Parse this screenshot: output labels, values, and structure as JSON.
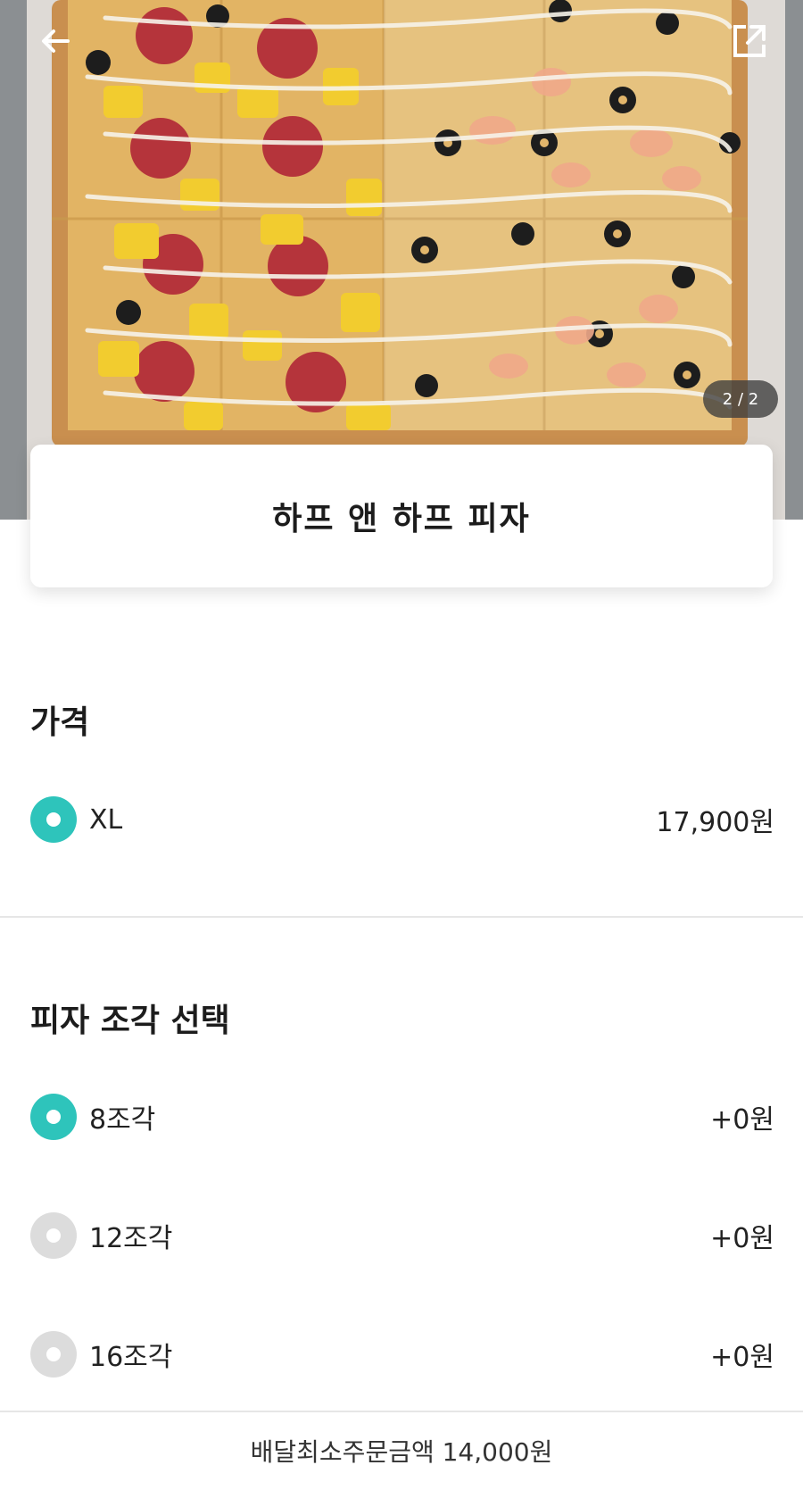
{
  "header": {
    "image_counter": "2 / 2"
  },
  "product": {
    "name": "하프 앤 하프 피자"
  },
  "price_section": {
    "title": "가격",
    "options": [
      {
        "label": "XL",
        "price": "17,900원",
        "selected": true
      }
    ]
  },
  "slice_section": {
    "title": "피자 조각 선택",
    "options": [
      {
        "label": "8조각",
        "price": "+0원",
        "selected": true
      },
      {
        "label": "12조각",
        "price": "+0원",
        "selected": false
      },
      {
        "label": "16조각",
        "price": "+0원",
        "selected": false
      }
    ]
  },
  "footer": {
    "min_order_text": "배달최소주문금액 14,000원"
  },
  "icons": {
    "back": "back-arrow-icon",
    "share": "share-icon"
  },
  "colors": {
    "accent": "#2ec4bb",
    "radio_off": "#dcdcdc"
  }
}
